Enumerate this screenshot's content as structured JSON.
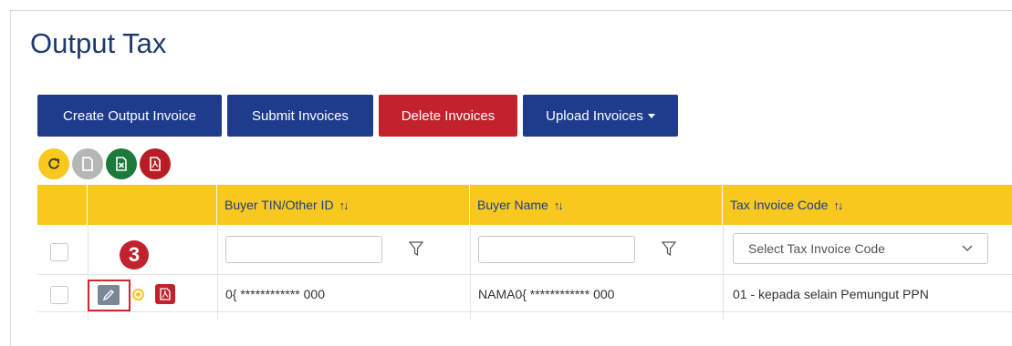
{
  "page": {
    "title": "Output Tax"
  },
  "toolbar": {
    "create_label": "Create Output Invoice",
    "submit_label": "Submit Invoices",
    "delete_label": "Delete Invoices",
    "upload_label": "Upload Invoices"
  },
  "icon_buttons": [
    {
      "name": "refresh-icon",
      "color": "#f7c81e"
    },
    {
      "name": "document-icon",
      "color": "#b6b6b6"
    },
    {
      "name": "excel-icon",
      "color": "#1c7a3a"
    },
    {
      "name": "pdf-icon",
      "color": "#b81d24"
    }
  ],
  "table": {
    "columns": [
      {
        "label": "Buyer TIN/Other ID",
        "sort": "↑↓"
      },
      {
        "label": "Buyer Name",
        "sort": "↑↓"
      },
      {
        "label": "Tax Invoice Code",
        "sort": "↑↓"
      }
    ],
    "filters": {
      "buyer_tin": "",
      "buyer_name": "",
      "tax_code_placeholder": "Select Tax Invoice Code"
    },
    "rows": [
      {
        "buyer_tin": "0{ ************ 000",
        "buyer_name": "NAMA0{ ************ 000",
        "tax_code": "01 - kepada selain Pemungut PPN"
      }
    ]
  },
  "annotation": {
    "step": "3"
  },
  "colors": {
    "accent_yellow": "#f7c81e",
    "primary_blue": "#1f3b8c",
    "danger_red": "#c1222d",
    "success_green": "#1c7a3a"
  }
}
